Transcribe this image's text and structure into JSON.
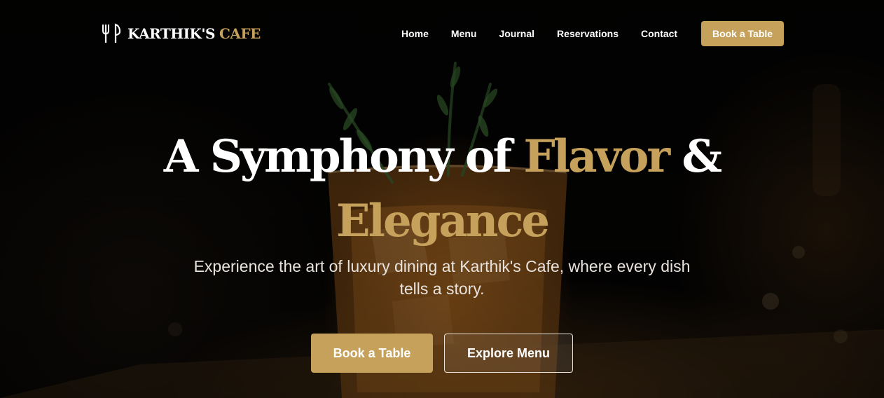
{
  "brand": {
    "icon": "fork-knife-icon",
    "name": "KARTHIK'S",
    "accent": "CAFE"
  },
  "nav": {
    "links": [
      "Home",
      "Menu",
      "Journal",
      "Reservations",
      "Contact"
    ],
    "cta_label": "Book a Table"
  },
  "hero": {
    "headline_part1": "A Symphony of ",
    "headline_accent1": "Flavor",
    "headline_part2": " & ",
    "headline_accent2": "Elegance",
    "subtitle": "Experience the art of luxury dining at Karthik's Cafe, where every dish tells a story.",
    "primary_button": "Book a Table",
    "secondary_button": "Explore Menu"
  },
  "colors": {
    "accent": "#c6a15b",
    "text": "#ffffff",
    "background": "#050403"
  }
}
